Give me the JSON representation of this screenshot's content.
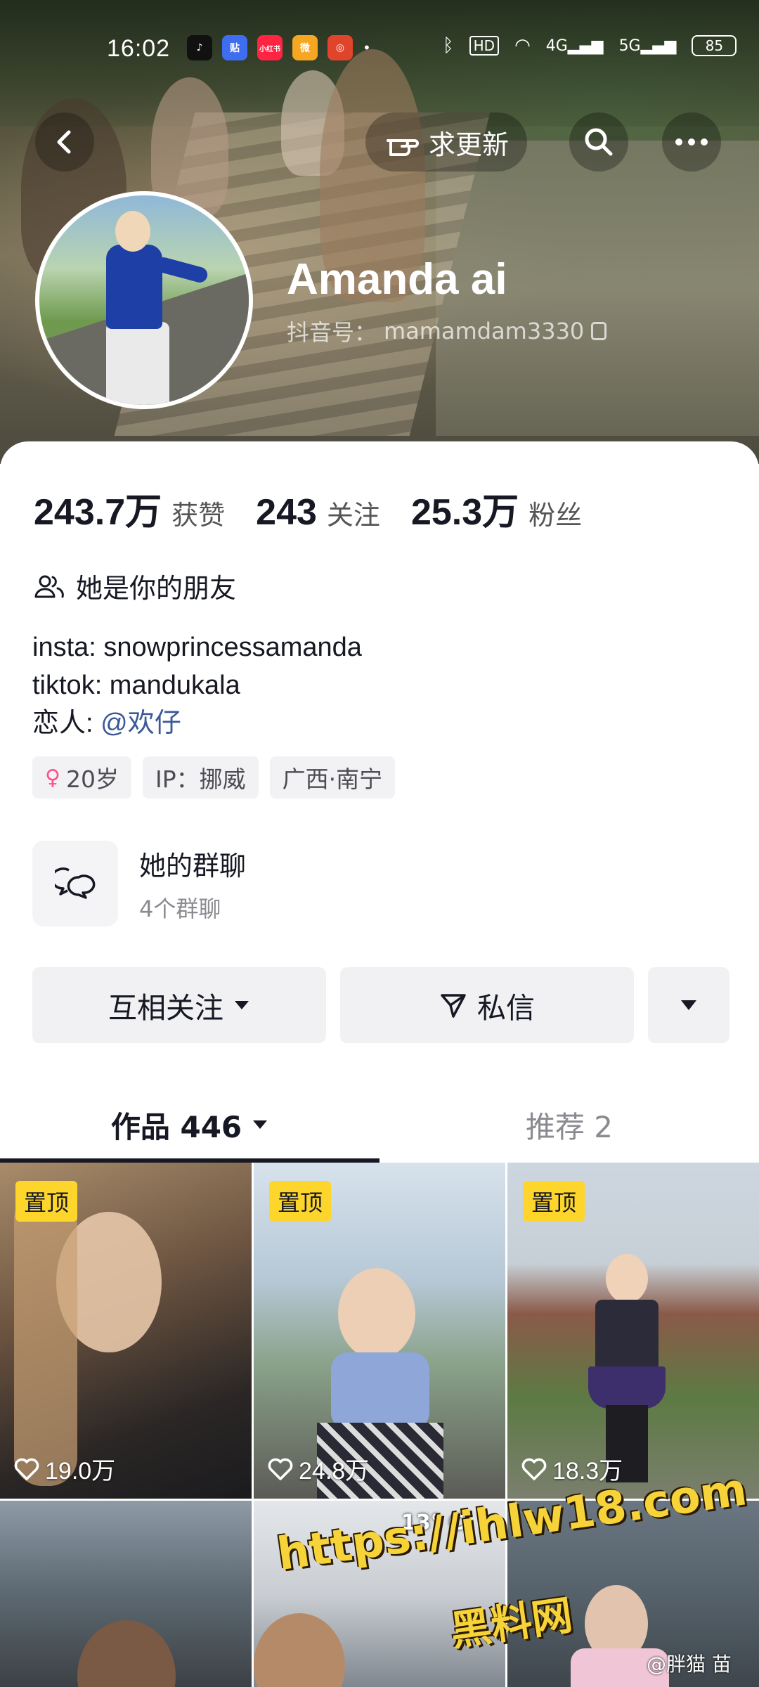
{
  "status_bar": {
    "time": "16:02",
    "apps": [
      {
        "icon": "tiktok-icon",
        "color": "#000000",
        "glyph": "♪"
      },
      {
        "icon": "tieba-icon",
        "color": "#3f6df0",
        "glyph": "贴"
      },
      {
        "icon": "xiaohongshu-icon",
        "color": "#ff2442",
        "glyph": "小红书"
      },
      {
        "icon": "weibo-icon",
        "color": "#f5a623",
        "glyph": "微"
      },
      {
        "icon": "app-icon",
        "color": "#e0442a",
        "glyph": "◎"
      }
    ],
    "network": "HD",
    "signal_1": "4G",
    "signal_2": "5G",
    "battery": "85"
  },
  "header": {
    "back_icon": "chevron-left-icon",
    "update_label": "求更新",
    "search_icon": "search-icon",
    "more_icon": "more-icon"
  },
  "profile": {
    "name": "Amanda ai",
    "douyin_id_label": "抖音号：",
    "douyin_id": "mamamdam3330"
  },
  "stats": [
    {
      "value": "243.7万",
      "label": "获赞"
    },
    {
      "value": "243",
      "label": "关注"
    },
    {
      "value": "25.3万",
      "label": "粉丝"
    }
  ],
  "relation": "她是你的朋友",
  "bio": {
    "line1": "insta: snowprincessamanda",
    "line2": "tiktok: mandukala",
    "line3_prefix": "恋人: ",
    "line3_mention": "@欢仔"
  },
  "tags": {
    "age": "20岁",
    "ip": "IP：挪威",
    "location": "广西·南宁"
  },
  "group_chat": {
    "title": "她的群聊",
    "subtitle": "4个群聊"
  },
  "actions": {
    "follow": "互相关注",
    "message": "私信"
  },
  "tabs": {
    "works": "作品 446",
    "recommend": "推荐 2"
  },
  "videos": [
    {
      "pinned": "置顶",
      "likes": "19.0万",
      "colors": [
        "#7b6a4a",
        "#2c2a2a"
      ]
    },
    {
      "pinned": "置顶",
      "likes": "24.8万",
      "colors": [
        "#c8d6e4",
        "#3b3f52"
      ]
    },
    {
      "pinned": "置顶",
      "likes": "18.3万",
      "colors": [
        "#b9c5cf",
        "#556b3d"
      ]
    },
    {
      "pinned": "",
      "likes": "",
      "colors": [
        "#6f7c8a",
        "#3a3d40"
      ]
    },
    {
      "pinned": "",
      "likes": "",
      "temp": "13° C",
      "colors": [
        "#d9dde2",
        "#6c7480"
      ]
    },
    {
      "pinned": "",
      "likes": "",
      "colors": [
        "#5e6b74",
        "#c7a7b3"
      ]
    }
  ],
  "watermark": {
    "url": "https://ihlw18.com",
    "site": "黑料网",
    "credit": "@胖猫 苗"
  }
}
